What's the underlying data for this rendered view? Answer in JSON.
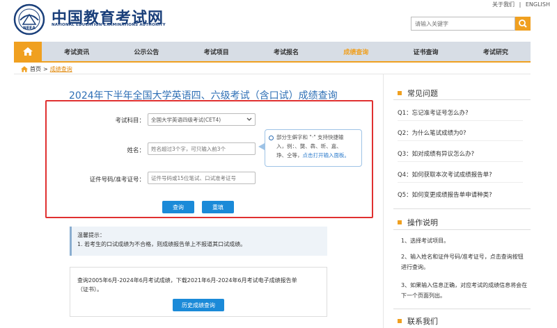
{
  "header": {
    "logo_cn": "中国教育考试网",
    "logo_en": "NATIONAL EDUCATION EXAMINATIONS AUTHORITY",
    "logo_badge": "NEEA",
    "toplinks": [
      "关于我们",
      "|",
      "ENGLISH"
    ],
    "search_placeholder": "请输入关键字"
  },
  "nav": {
    "items": [
      "考试资讯",
      "公示公告",
      "考试项目",
      "考试报名",
      "成绩查询",
      "证书查询",
      "考试研究"
    ],
    "active": "成绩查询"
  },
  "breadcrumb": {
    "home": "首页",
    "sep": ">",
    "current": "成绩查询"
  },
  "main": {
    "title": "2024年下半年全国大学英语四、六级考试（含口试）成绩查询",
    "subject_label": "考试科目：",
    "subject_value": "全国大学英语四级考试(CET4)",
    "name_label": "姓名：",
    "name_placeholder": "姓名超过3个字，可只输入前3个",
    "id_label": "证件号码/准考证号：",
    "id_placeholder": "证件号码或15位笔试、口试准考证号",
    "tip_line1": "部分生僻字和 \"·\" 支持快捷输",
    "tip_line2": "入，例：、龑、犇、昕、嘉、",
    "tip_line3a": "琤、仝等，",
    "tip_line3b": "点击打开输入面板。",
    "query_button": "查询",
    "reset_button": "重填",
    "warm_title": "温馨提示：",
    "warm_text": "1. 若考生的口试成绩为不合格，则成绩报告单上不报道其口试成绩。",
    "history_line1": "查询2005年6月-2024年6月考试成绩，下载2021年6月-2024年6月考试电子成绩报告单",
    "history_line2": "（证书）。",
    "history_button": "历史成绩查询"
  },
  "sidebar": {
    "faq_title": "常见问题",
    "faq": [
      "Q1：忘记准考证号怎么办?",
      "Q2：为什么笔试成绩为0?",
      "Q3：如对成绩有异议怎么办?",
      "Q4：如何获取本次考试成绩报告单?",
      "Q5：如何变更成绩报告单申请种类?"
    ],
    "guide_title": "操作说明",
    "steps": [
      "1、选择考试项目。",
      "2、输入姓名和证件号码/准考证号，点击查询按钮进行查询。",
      "3、如果输入信息正确，对应考试的成绩信息将会在下一个页面列出。"
    ],
    "contact_title": "联系我们"
  },
  "colors": {
    "accent": "#f0a020",
    "primary": "#1b8ad8",
    "title": "#2e6fb5",
    "highlight": "#e03030"
  }
}
